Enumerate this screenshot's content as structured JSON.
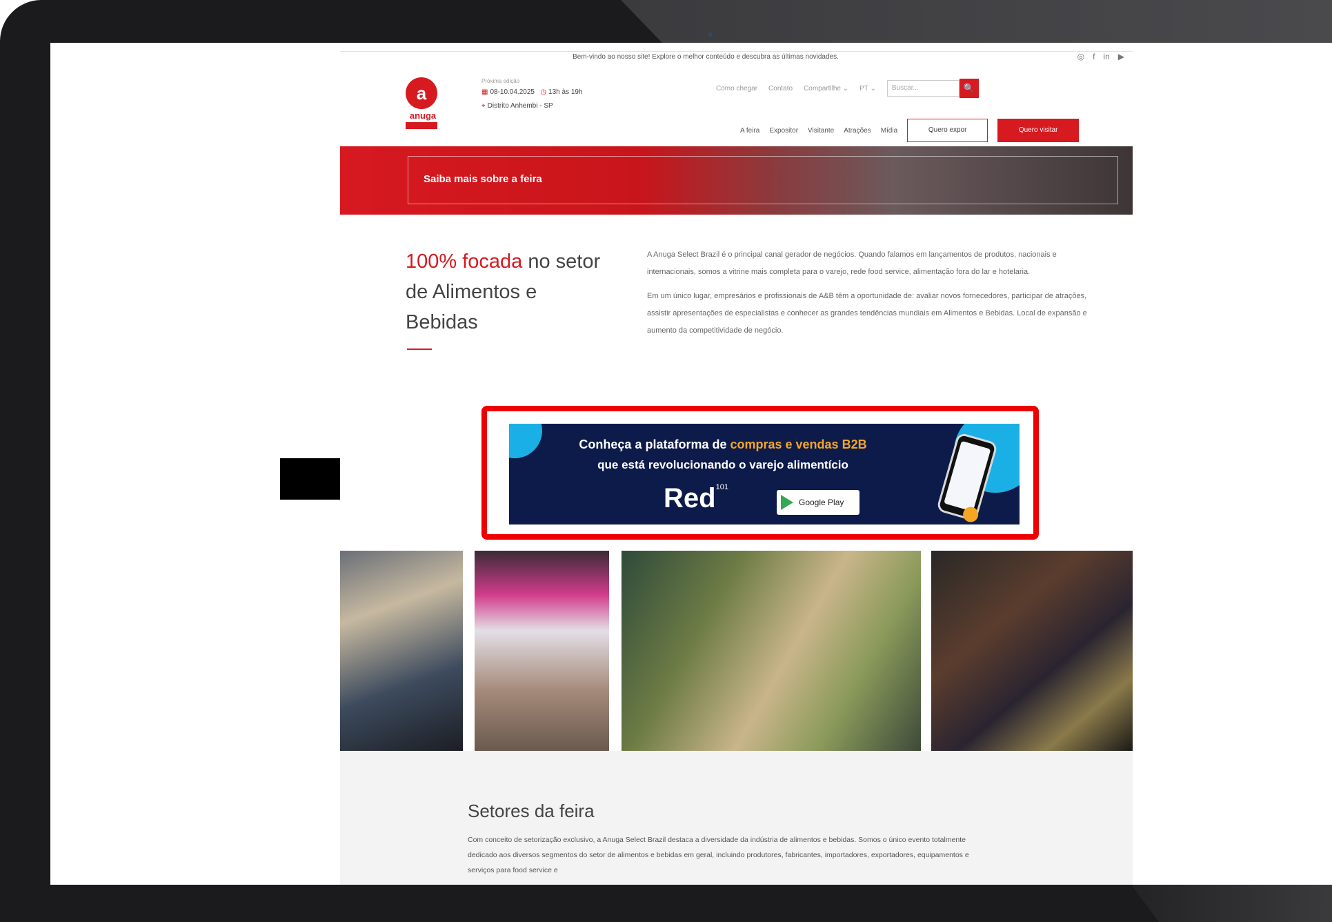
{
  "topbar": {
    "welcome": "Bem-vindo ao nosso site! Explore o melhor conteúdo e descubra as últimas novidades.",
    "social_icons": [
      "instagram-icon",
      "facebook-icon",
      "linkedin-icon",
      "youtube-icon"
    ],
    "social_glyphs": {
      "instagram": "◎",
      "facebook": "f",
      "linkedin": "in",
      "youtube": "▶"
    }
  },
  "header": {
    "logo_mark": "a",
    "logo_name": "anuga",
    "event_caption": "Próxima edição",
    "event_dates": "08-10.04.2025",
    "event_hours": "13h às 19h",
    "event_location": "Distrito Anhembi - SP",
    "util_links": [
      "Como chegar",
      "Contato",
      "Compartilhe ⌄",
      "PT ⌄"
    ],
    "search_placeholder": "Buscar...",
    "search_glyph": "🔍",
    "nav": [
      "A feira",
      "Expositor",
      "Visitante",
      "Atrações",
      "Mídia"
    ],
    "cta_exhibit": "Quero expor",
    "cta_visit": "Quero visitar"
  },
  "hero": {
    "label": "Saiba mais sobre a feira"
  },
  "intro": {
    "title_accent": "100% focada",
    "title_rest": " no setor de Alimentos e Bebidas",
    "paragraph1": "A Anuga Select Brazil é o principal canal gerador de negócios. Quando falamos em lançamentos de produtos, nacionais e internacionais, somos a vitrine mais completa para o varejo, rede food service, alimentação fora do lar e hotelaria.",
    "paragraph2": "Em um único lugar, empresários e profissionais de A&B têm a oportunidade de: avaliar novos fornecedores, participar de atrações, assistir apresentações de especialistas e conhecer as grandes tendências mundiais em Alimentos e Bebidas. Local de expansão e aumento da competitividade de negócio."
  },
  "banner": {
    "line1_prefix": "Conheça a plataforma de ",
    "line1_highlight": "compras e vendas B2B",
    "line2": "que está revolucionando o varejo alimentício",
    "brand": "Red",
    "brand_sup": "101",
    "store_badge": "Google Play",
    "highlight_color": "#ee0000"
  },
  "sectors": {
    "title": "Setores da feira",
    "body": "Com conceito de setorização exclusivo, a Anuga Select Brazil destaca a diversidade da indústria de alimentos e bebidas. Somos o único evento totalmente dedicado aos diversos segmentos do setor de alimentos e bebidas em geral, incluindo produtores, fabricantes, importadores, exportadores, equipamentos e serviços para food service e"
  },
  "colors": {
    "brand_red": "#d71920",
    "banner_navy": "#0d1b4a",
    "banner_gold": "#f5a623",
    "banner_cyan": "#1ab0e6"
  }
}
